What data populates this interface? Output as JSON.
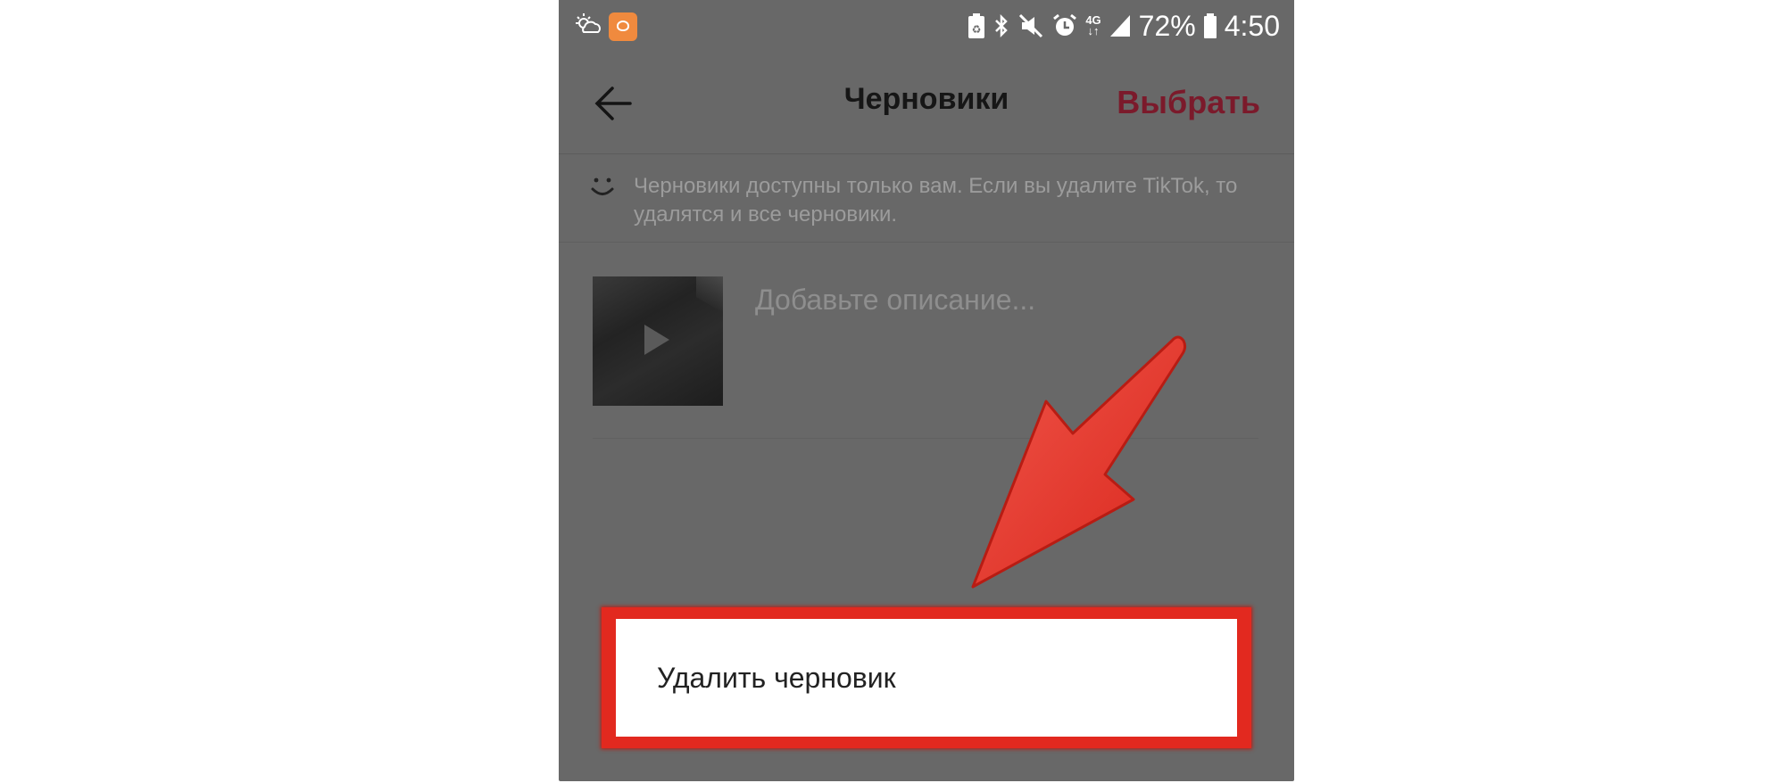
{
  "status_bar": {
    "battery": "72%",
    "time": "4:50",
    "network": "4G",
    "icons": [
      "weather-icon",
      "app-notification-icon",
      "battery-saver-icon",
      "bluetooth-icon",
      "mute-icon",
      "alarm-icon",
      "network-4g-icon",
      "signal-icon",
      "battery-icon"
    ]
  },
  "header": {
    "title": "Черновики",
    "select_label": "Выбрать",
    "back_icon": "back-arrow-icon"
  },
  "notice": {
    "icon": "smile-icon",
    "text": "Черновики доступны только вам. Если вы удалите TikTok, то удалятся и все черновики."
  },
  "drafts": [
    {
      "description_placeholder": "Добавьте описание...",
      "thumbnail_icon": "play-icon"
    }
  ],
  "popup": {
    "menu_item": "Удалить черновик"
  },
  "colors": {
    "overlay": "#686868",
    "accent": "#7b1a2b",
    "highlight": "#e2291f"
  }
}
